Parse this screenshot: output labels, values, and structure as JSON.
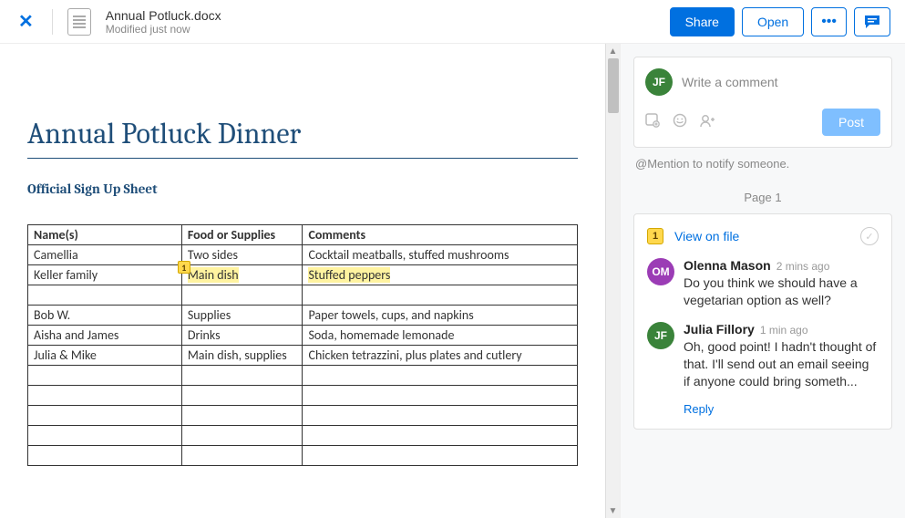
{
  "header": {
    "file_name": "Annual Potluck.docx",
    "modified": "Modified just now",
    "share_label": "Share",
    "open_label": "Open"
  },
  "document": {
    "title": "Annual Potluck Dinner",
    "subtitle": "Official Sign Up Sheet",
    "columns": [
      "Name(s)",
      "Food or Supplies",
      "Comments"
    ],
    "rows": [
      {
        "name": "Camellia",
        "food": "Two sides",
        "comments": "Cocktail meatballs, stuffed mushrooms",
        "highlight": false
      },
      {
        "name": "Keller family",
        "food": "Main dish",
        "comments": "Stuffed peppers",
        "highlight": true,
        "badge": "1"
      },
      {
        "name": "",
        "food": "",
        "comments": ""
      },
      {
        "name": "Bob W.",
        "food": "Supplies",
        "comments": "Paper towels, cups, and napkins"
      },
      {
        "name": "Aisha and James",
        "food": "Drinks",
        "comments": "Soda, homemade lemonade"
      },
      {
        "name": "Julia & Mike",
        "food": "Main dish, supplies",
        "comments": "Chicken tetrazzini, plus plates and cutlery"
      },
      {
        "name": "",
        "food": "",
        "comments": ""
      },
      {
        "name": "",
        "food": "",
        "comments": ""
      },
      {
        "name": "",
        "food": "",
        "comments": ""
      },
      {
        "name": "",
        "food": "",
        "comments": ""
      },
      {
        "name": "",
        "food": "",
        "comments": ""
      }
    ]
  },
  "comments_panel": {
    "composer_placeholder": "Write a comment",
    "post_label": "Post",
    "mention_hint": "@Mention to notify someone.",
    "page_label": "Page 1",
    "thread": {
      "badge": "1",
      "view_label": "View on file",
      "comments": [
        {
          "initials": "OM",
          "avatar_color": "purple",
          "author": "Olenna Mason",
          "time": "2 mins ago",
          "text": "Do you think we should have a vegetarian option as well?"
        },
        {
          "initials": "JF",
          "avatar_color": "green",
          "author": "Julia Fillory",
          "time": "1 min ago",
          "text": "Oh, good point! I hadn't thought of that. I'll send out an email seeing if anyone could bring someth..."
        }
      ],
      "reply_label": "Reply"
    },
    "composer_initials": "JF"
  }
}
